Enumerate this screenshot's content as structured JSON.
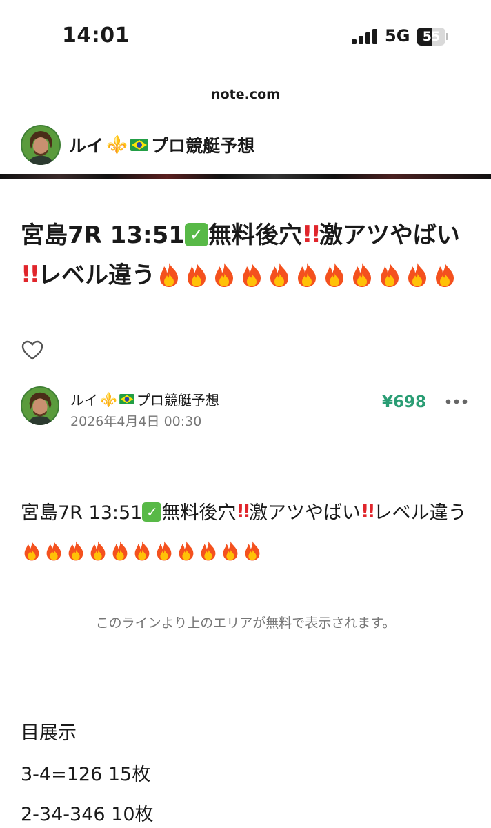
{
  "status_bar": {
    "time": "14:01",
    "network": "5G",
    "battery": "55",
    "battery_level": 0.55
  },
  "browser": {
    "domain": "note.com"
  },
  "author": {
    "name_prefix": "ルイ",
    "name_suffix": "プロ競艇予想",
    "fleur_emoji": "⚜️",
    "flag_emoji": "🇧🇷"
  },
  "article": {
    "title_parts": [
      "宮島7R 13:51",
      "無料後穴",
      "激アツやばい",
      "レベル違う"
    ],
    "title_fire_count": 11,
    "date": "2026年4月4日 00:30",
    "price": "¥698",
    "body_parts": [
      "宮島7R 13:51",
      "無料後穴",
      "激アツやばい",
      "レベル違う"
    ],
    "body_fire_count": 11,
    "free_line_text": "このラインより上のエリアが無料で表示されます。",
    "lines": [
      "目展示",
      "3-4=126 15枚",
      "2-34-346 10枚"
    ]
  },
  "icons": {
    "check": "white-heavy-check-mark-emoji",
    "bang": "double-exclamation-mark-emoji",
    "fire": "fire-emoji",
    "like": "heart-outline-icon",
    "more": "ellipsis-icon"
  },
  "colors": {
    "price": "#2a9d74",
    "check": "#58b947",
    "bang": "#e0252b"
  }
}
